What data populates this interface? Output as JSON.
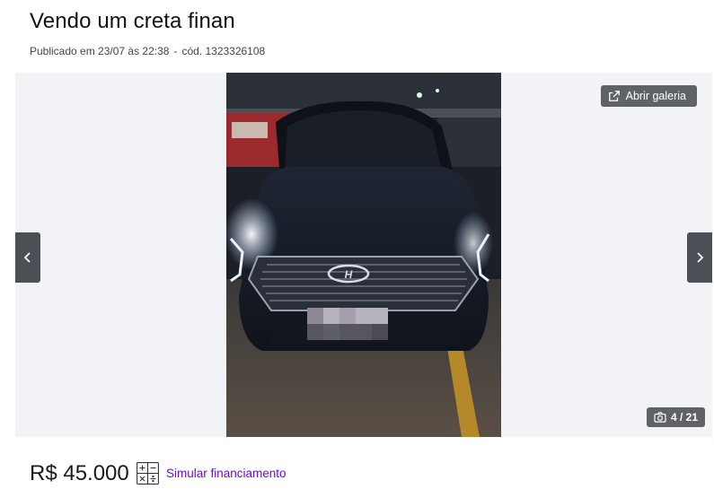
{
  "listing": {
    "title": "Vendo um creta finan",
    "published": "Publicado em 23/07 às 22:38",
    "separator": "-",
    "code": "cód. 1323326108"
  },
  "gallery": {
    "open_label": "Abrir galeria",
    "counter": "4 / 21",
    "photo_description_icon": "car-photo",
    "icons": {
      "open": "external-link-icon",
      "prev": "chevron-left-icon",
      "next": "chevron-right-icon",
      "counter": "camera-icon"
    }
  },
  "price": {
    "value": "R$ 45.000",
    "simulate_label": "Simular financiamento",
    "accent_color": "#6e0ad6"
  }
}
